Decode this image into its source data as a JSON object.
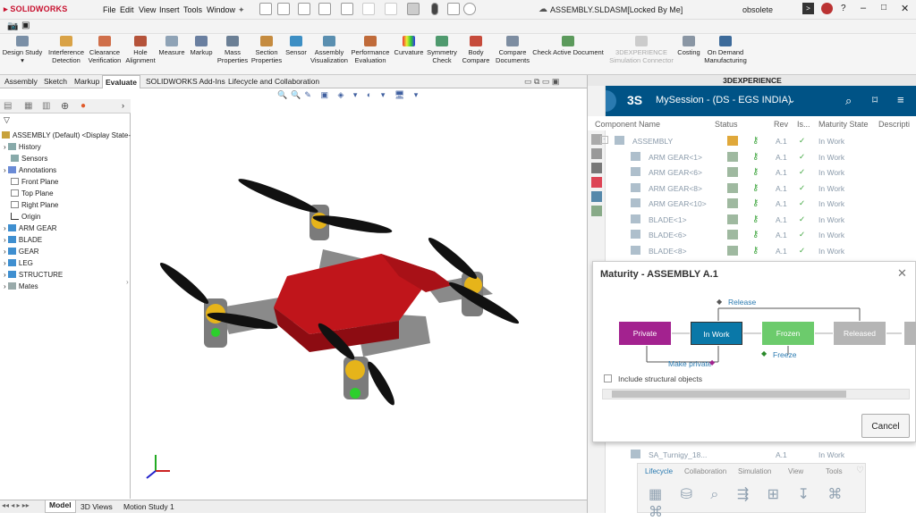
{
  "app": {
    "logo": "SOLIDWORKS",
    "document_title": "ASSEMBLY.SLDASM[Locked By Me]",
    "user_status": "obsolete"
  },
  "menus": [
    "File",
    "Edit",
    "View",
    "Insert",
    "Tools",
    "Window"
  ],
  "ribbon": [
    "Design Study",
    "Interference Detection",
    "Clearance Verification",
    "Hole Alignment",
    "Measure",
    "Markup",
    "Mass Properties",
    "Section Properties",
    "Sensor",
    "Assembly Visualization",
    "Performance Evaluation",
    "Curvature",
    "Symmetry Check",
    "Body Compare",
    "Compare Documents",
    "Check Active Document",
    "3DEXPERIENCE Simulation Connector",
    "Costing",
    "On Demand Manufacturing"
  ],
  "command_tabs": [
    "Assembly",
    "Sketch",
    "Markup",
    "Evaluate",
    "SOLIDWORKS Add-Ins",
    "Lifecycle and Collaboration"
  ],
  "active_command_tab": "Evaluate",
  "feature_tree": {
    "root": "ASSEMBLY (Default) <Display State-1",
    "items": [
      "History",
      "Sensors",
      "Annotations",
      "Front Plane",
      "Top Plane",
      "Right Plane",
      "Origin",
      "ARM GEAR",
      "BLADE",
      "GEAR",
      "LEG",
      "STRUCTURE",
      "Mates"
    ]
  },
  "bottom_tabs": [
    "Model",
    "3D Views",
    "Motion Study 1"
  ],
  "task_pane": {
    "title": "3DEXPERIENCE",
    "session": "MySession - (DS - EGS INDIA)",
    "columns": [
      "Component Name",
      "Status",
      "Rev",
      "Is...",
      "Maturity State",
      "Descripti"
    ],
    "rows": [
      {
        "name": "ASSEMBLY",
        "rev": "A.1",
        "state": "In Work"
      },
      {
        "name": "ARM GEAR<1>",
        "rev": "A.1",
        "state": "In Work"
      },
      {
        "name": "ARM GEAR<6>",
        "rev": "A.1",
        "state": "In Work"
      },
      {
        "name": "ARM GEAR<8>",
        "rev": "A.1",
        "state": "In Work"
      },
      {
        "name": "ARM GEAR<10>",
        "rev": "A.1",
        "state": "In Work"
      },
      {
        "name": "BLADE<1>",
        "rev": "A.1",
        "state": "In Work"
      },
      {
        "name": "BLADE<6>",
        "rev": "A.1",
        "state": "In Work"
      },
      {
        "name": "BLADE<8>",
        "rev": "A.1",
        "state": "In Work"
      }
    ],
    "bottom_row": {
      "name": "SA_Turnigy_18...",
      "rev": "A.1",
      "state": "In Work"
    },
    "bottom_tabs": [
      "Lifecycle",
      "Collaboration",
      "Simulation",
      "View",
      "Tools"
    ]
  },
  "maturity_dialog": {
    "title": "Maturity - ASSEMBLY A.1",
    "states": [
      "Private",
      "In Work",
      "Frozen",
      "Released"
    ],
    "transitions": {
      "release": "Release",
      "make_private": "Make private",
      "freeze": "Freeze"
    },
    "include_label": "Include structural objects",
    "cancel": "Cancel"
  },
  "colors": {
    "private": "#a3228f",
    "in_work": "#0a78a8",
    "frozen": "#6ccb6c",
    "released": "#b5b5b5",
    "session_bar": "#005386"
  }
}
